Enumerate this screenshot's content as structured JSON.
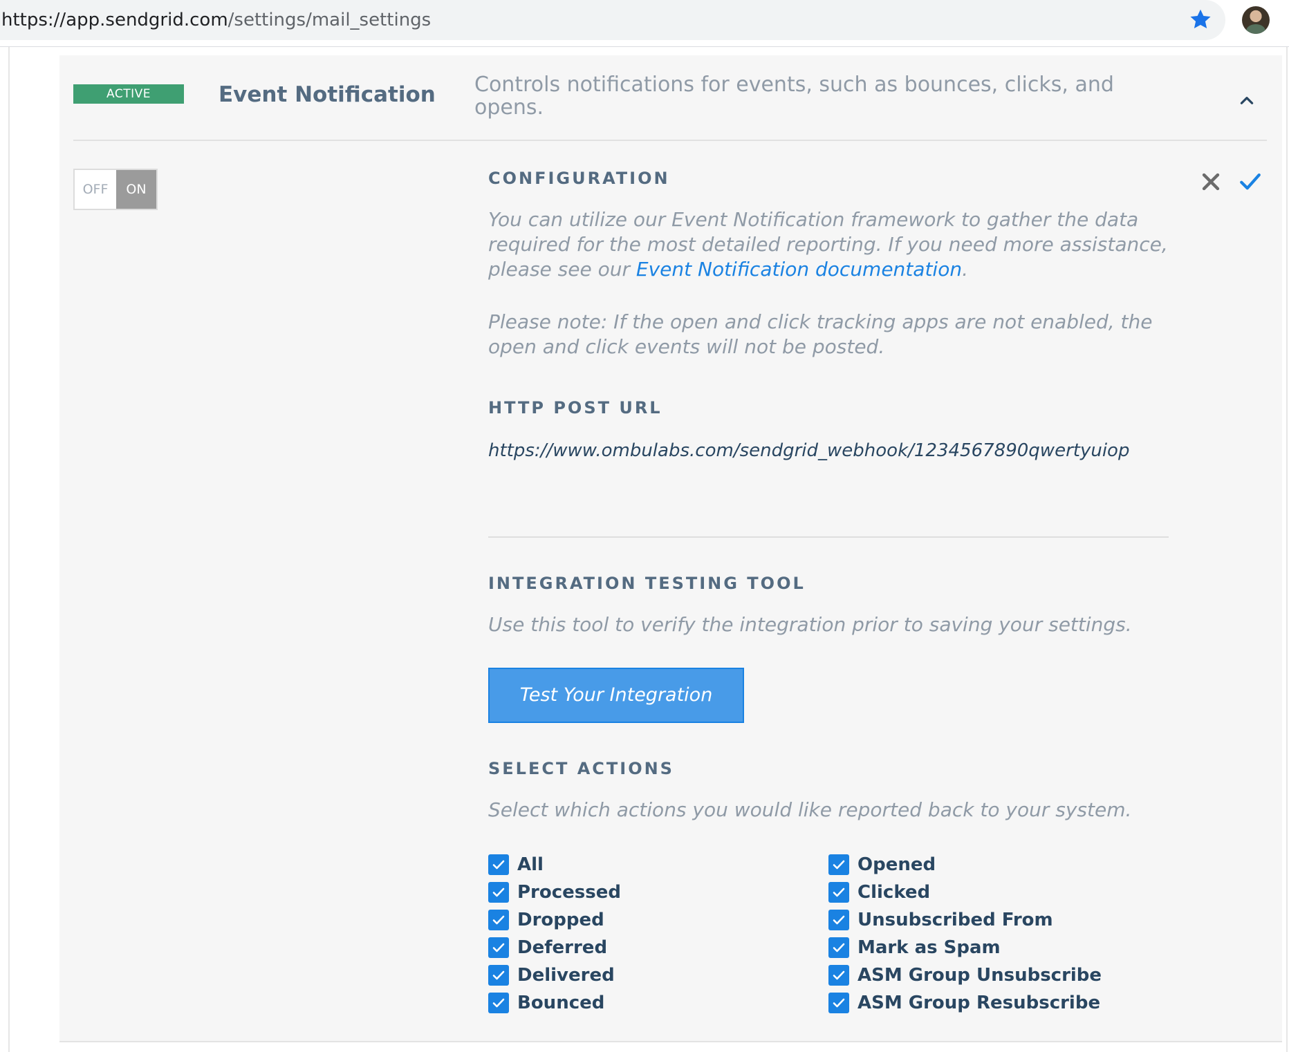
{
  "browser": {
    "url_host": "https://app.sendgrid.com",
    "url_path": "/settings/mail_settings"
  },
  "setting": {
    "status_badge": "ACTIVE",
    "title": "Event Notification",
    "description": "Controls notifications for events, such as bounces, clicks, and opens.",
    "expanded": true
  },
  "toggle": {
    "off_label": "OFF",
    "on_label": "ON",
    "state": "on"
  },
  "configuration": {
    "heading": "CONFIGURATION",
    "intro_text": "You can utilize our Event Notification framework to gather the data required for the most detailed reporting. If you need more assistance, please see our ",
    "intro_link": "Event Notification documentation",
    "intro_end": ".",
    "note": "Please note: If the open and click tracking apps are not enabled, the open and click events will not be posted."
  },
  "http_post": {
    "heading": "HTTP POST URL",
    "value": "https://www.ombulabs.com/sendgrid_webhook/1234567890qwertyuiop"
  },
  "integration_testing": {
    "heading": "INTEGRATION TESTING TOOL",
    "description": "Use this tool to verify the integration prior to saving your settings.",
    "button_label": "Test Your Integration"
  },
  "select_actions": {
    "heading": "SELECT ACTIONS",
    "description": "Select which actions you would like reported back to your system.",
    "left": [
      {
        "label": "All",
        "checked": true
      },
      {
        "label": "Processed",
        "checked": true
      },
      {
        "label": "Dropped",
        "checked": true
      },
      {
        "label": "Deferred",
        "checked": true
      },
      {
        "label": "Delivered",
        "checked": true
      },
      {
        "label": "Bounced",
        "checked": true
      }
    ],
    "right": [
      {
        "label": "Opened",
        "checked": true
      },
      {
        "label": "Clicked",
        "checked": true
      },
      {
        "label": "Unsubscribed From",
        "checked": true
      },
      {
        "label": "Mark as Spam",
        "checked": true
      },
      {
        "label": "ASM Group Unsubscribe",
        "checked": true
      },
      {
        "label": "ASM Group Resubscribe",
        "checked": true
      }
    ]
  },
  "colors": {
    "badge_green": "#3f9f72",
    "link_blue": "#1a82e2",
    "button_blue": "#489be8",
    "heading_slate": "#546b81",
    "muted_text": "#8f9aa6"
  },
  "icons": [
    "star-icon",
    "avatar",
    "chevron-up-icon",
    "close-icon",
    "check-icon",
    "checkbox-checked-icon"
  ]
}
